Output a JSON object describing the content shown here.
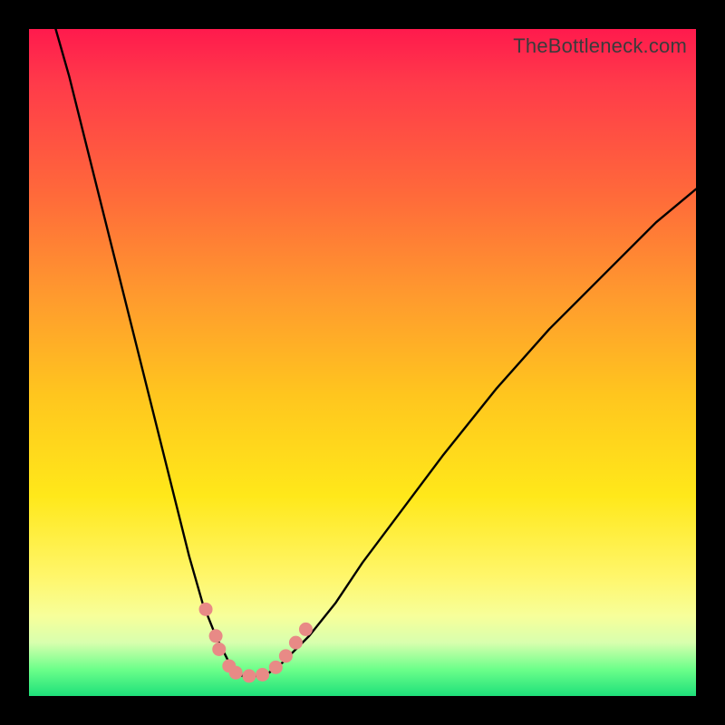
{
  "watermark": "TheBottleneck.com",
  "chart_data": {
    "type": "line",
    "title": "",
    "xlabel": "",
    "ylabel": "",
    "xlim": [
      0,
      100
    ],
    "ylim": [
      0,
      100
    ],
    "grid": false,
    "series": [
      {
        "name": "curve",
        "x": [
          4,
          6,
          8,
          10,
          12,
          14,
          16,
          18,
          20,
          22,
          24,
          26,
          28,
          30,
          31,
          32,
          34,
          36,
          38,
          42,
          46,
          50,
          56,
          62,
          70,
          78,
          86,
          94,
          100
        ],
        "y": [
          100,
          93,
          85,
          77,
          69,
          61,
          53,
          45,
          37,
          29,
          21,
          14,
          9,
          5,
          3.5,
          3,
          3,
          3.5,
          5,
          9,
          14,
          20,
          28,
          36,
          46,
          55,
          63,
          71,
          76
        ]
      }
    ],
    "dots": {
      "name": "markers",
      "points": [
        {
          "x": 26.5,
          "y": 13
        },
        {
          "x": 28,
          "y": 9
        },
        {
          "x": 28.5,
          "y": 7
        },
        {
          "x": 30,
          "y": 4.5
        },
        {
          "x": 31,
          "y": 3.5
        },
        {
          "x": 33,
          "y": 3
        },
        {
          "x": 35,
          "y": 3.2
        },
        {
          "x": 37,
          "y": 4.3
        },
        {
          "x": 38.5,
          "y": 6
        },
        {
          "x": 40,
          "y": 8
        },
        {
          "x": 41.5,
          "y": 10
        }
      ]
    },
    "background_gradient": {
      "top": "#ff1a4d",
      "mid1": "#ff9a2e",
      "mid2": "#ffe81a",
      "bottom": "#1ee07a"
    }
  }
}
